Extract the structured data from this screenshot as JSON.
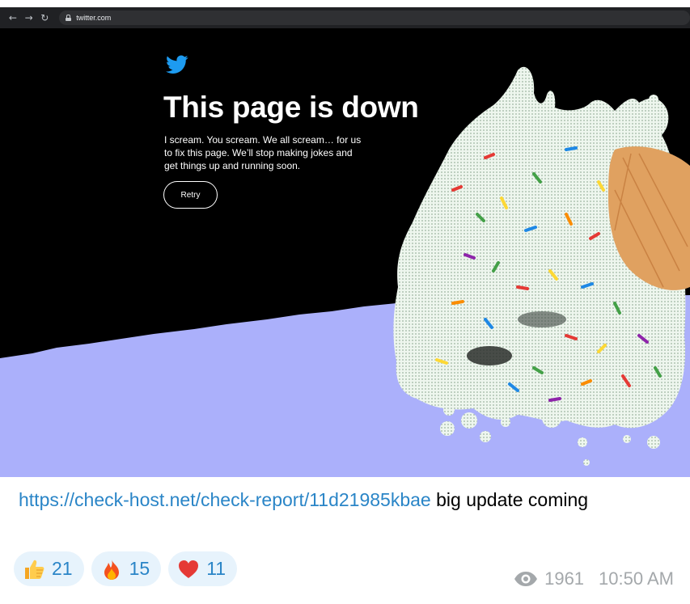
{
  "browser": {
    "back_glyph": "←",
    "forward_glyph": "→",
    "reload_glyph": "↻",
    "url": "twitter.com"
  },
  "error_page": {
    "logo": "twitter-bird",
    "headline": "This page is down",
    "message": "I scream. You scream. We all scream… for us to fix this page. We’ll stop making jokes and get things up and running soon.",
    "retry_label": "Retry"
  },
  "message": {
    "link_text": "https://check-host.net/check-report/11d21985kbae",
    "text": " big update coming",
    "views": "1961",
    "time": "10:50 AM"
  },
  "reactions": [
    {
      "emoji": "thumbs-up",
      "count": "21"
    },
    {
      "emoji": "fire",
      "count": "15"
    },
    {
      "emoji": "red-heart",
      "count": "11"
    }
  ],
  "colors": {
    "link": "#2a85c7",
    "reaction_bg": "#e7f3fc",
    "floor": "#abb0fb",
    "twitter_blue": "#1d9bf0"
  }
}
